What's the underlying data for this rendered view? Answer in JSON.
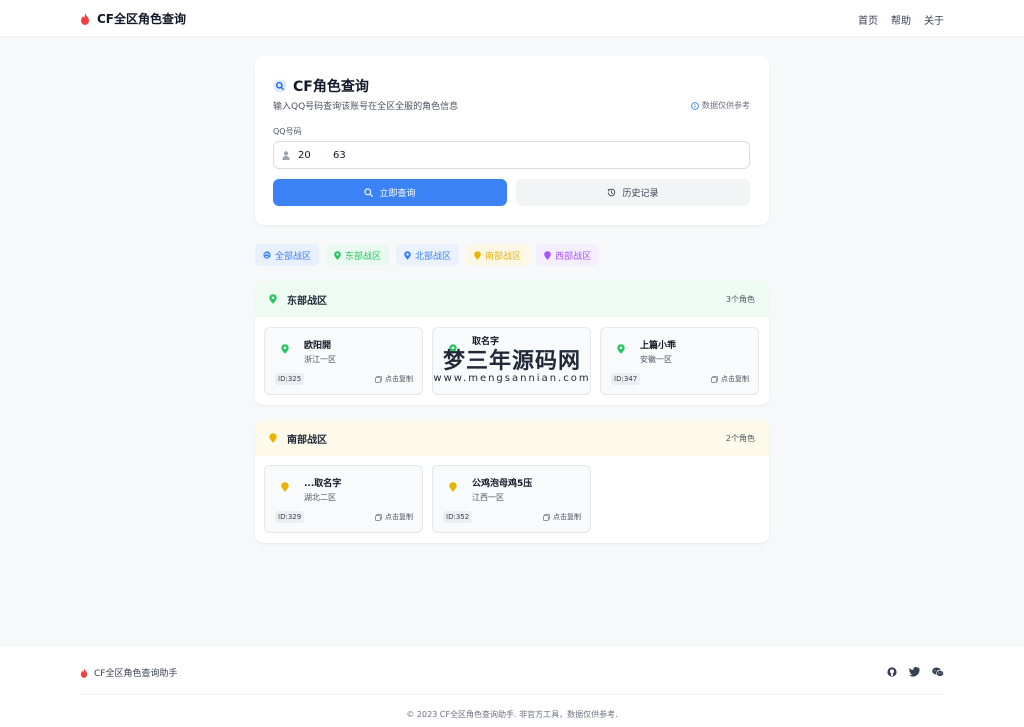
{
  "header": {
    "title": "CF全区角色查询",
    "nav": [
      "首页",
      "帮助",
      "关于"
    ]
  },
  "search": {
    "title": "CF角色查询",
    "subtitle": "输入QQ号码查询该账号在全区全服的角色信息",
    "note": "数据仅供参考",
    "field_label": "QQ号码",
    "qq_value": "20       63",
    "query_button": "立即查询",
    "history_button": "历史记录"
  },
  "tabs": [
    {
      "label": "全部战区",
      "color": "#3b82f6",
      "bg": "#e8effd"
    },
    {
      "label": "东部战区",
      "color": "#22c55e",
      "bg": "#eafaf0"
    },
    {
      "label": "北部战区",
      "color": "#3b82f6",
      "bg": "#ebf2fe"
    },
    {
      "label": "南部战区",
      "color": "#eab308",
      "bg": "#fdf8e6"
    },
    {
      "label": "西部战区",
      "color": "#a855f7",
      "bg": "#f5eefe"
    }
  ],
  "regions": [
    {
      "name": "东部战区",
      "count": "3个角色",
      "color": "#22c55e",
      "head_bg": "#edfbf2",
      "characters": [
        {
          "name": "欧阳開",
          "server": "浙江一区",
          "id": "ID:325",
          "copy": "点击复制"
        },
        {
          "name": "取名字",
          "server": "",
          "id": "",
          "copy": ""
        },
        {
          "name": "上篇小乖",
          "server": "安徽一区",
          "id": "ID:347",
          "copy": "点击复制"
        }
      ]
    },
    {
      "name": "南部战区",
      "count": "2个角色",
      "color": "#eab308",
      "head_bg": "#fefae9",
      "characters": [
        {
          "name": "...取名字",
          "server": "湖北二区",
          "id": "ID:329",
          "copy": "点击复制"
        },
        {
          "name": "公鸡泡母鸡5压",
          "server": "江西一区",
          "id": "ID:352",
          "copy": "点击复制"
        }
      ]
    }
  ],
  "watermark": {
    "title": "梦三年源码网",
    "url": "www.mengsannian.com"
  },
  "footer": {
    "brand": "CF全区角色查询助手",
    "copyright": "© 2023 CF全区角色查询助手. 非官方工具，数据仅供参考."
  },
  "colors": {
    "accent": "#3b82f6",
    "flame": "#ef4444"
  }
}
